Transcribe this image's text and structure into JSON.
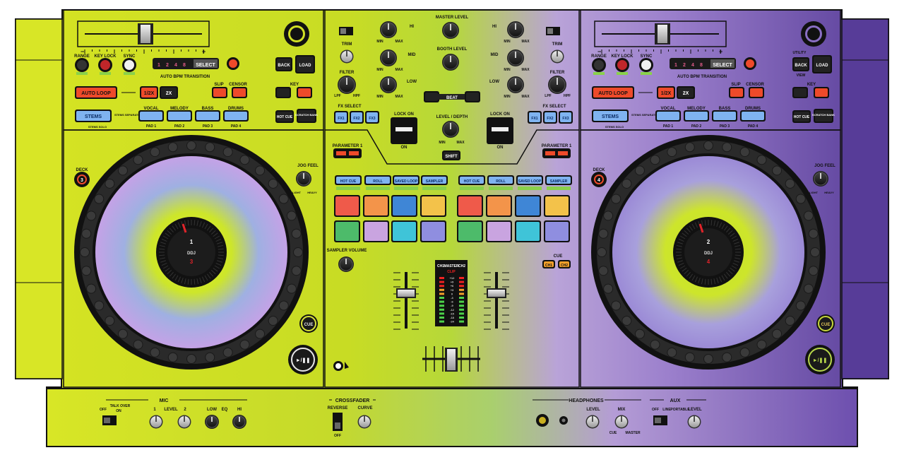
{
  "colors": {
    "lime": "#d8e626",
    "lime_dark": "#c6d81c",
    "purple": "#5a3f9a",
    "lavender": "#b699d8",
    "orange_red": "#ee4a2a",
    "pad_red": "#ef5a4a",
    "pad_orange": "#f3944a",
    "pad_blue": "#3f86d6",
    "pad_yellow": "#f3c24a",
    "pad_green": "#4dbb6a",
    "pad_lilac": "#c9a4e0",
    "pad_cyan": "#3fc4d8",
    "pad_periwinkle": "#8f8ee0",
    "screen_blue": "#7fb3f0"
  },
  "deck_left": {
    "range": "RANGE",
    "key_lock": "KEY LOCK",
    "sync": "SYNC",
    "beats": [
      "1",
      "2",
      "4",
      "8"
    ],
    "select": "SELECT",
    "auto_bpm": "AUTO BPM TRANSITION",
    "back": "BACK",
    "load": "LOAD",
    "auto_loop": "AUTO LOOP",
    "half": "1/2X",
    "double": "2X",
    "slip": "SLIP",
    "censor": "CENSOR",
    "key": "KEY",
    "stems": "STEMS",
    "stems_separate": "STEMS SEPARATE",
    "stems_solo": "STEMS SOLO",
    "vocal": "VOCAL",
    "melody": "MELODY",
    "bass": "BASS",
    "drums": "DRUMS",
    "pads": [
      "PAD 1",
      "PAD 2",
      "PAD 3",
      "PAD 4"
    ],
    "hot_cue": "HOT CUE",
    "scratch_bank": "SCRATCH BANK",
    "deck": "DECK",
    "deck_num": "3",
    "jog_feel": "JOG FEEL",
    "light": "LIGHT",
    "heavy": "HEAVY",
    "platter_top": "1",
    "platter_mid": "DDJ",
    "platter_bottom": "3",
    "cue": "CUE",
    "play": "►/❚❚"
  },
  "deck_right": {
    "range": "RANGE",
    "key_lock": "KEY LOCK",
    "sync": "SYNC",
    "beats": [
      "1",
      "2",
      "4",
      "8"
    ],
    "select": "SELECT",
    "auto_bpm": "AUTO BPM TRANSITION",
    "utility": "UTILITY",
    "back": "BACK",
    "load": "LOAD",
    "view": "VIEW",
    "auto_loop": "AUTO LOOP",
    "half": "1/2X",
    "double": "2X",
    "slip": "SLIP",
    "censor": "CENSOR",
    "key": "KEY",
    "stems": "STEMS",
    "stems_separate": "STEMS SEPARATE",
    "stems_solo": "STEMS SOLO",
    "vocal": "VOCAL",
    "melody": "MELODY",
    "bass": "BASS",
    "drums": "DRUMS",
    "pads": [
      "PAD 1",
      "PAD 2",
      "PAD 3",
      "PAD 4"
    ],
    "hot_cue": "HOT CUE",
    "scratch_bank": "SCRATCH BANK",
    "deck": "DECK",
    "deck_num": "4",
    "jog_feel": "JOG FEEL",
    "light": "LIGHT",
    "heavy": "HEAVY",
    "platter_top": "2",
    "platter_mid": "DDJ",
    "platter_bottom": "4",
    "cue": "CUE",
    "play": "►/❚❚"
  },
  "mixer": {
    "master_level": "MASTER LEVEL",
    "booth_level": "BOOTH LEVEL",
    "trim": "TRIM",
    "hi": "HI",
    "mid": "MID",
    "low": "LOW",
    "filter": "FILTER",
    "lpf": "LPF",
    "hpf": "HPF",
    "min": "MIN",
    "max": "MAX",
    "beat": "BEAT",
    "fx_select": "FX SELECT",
    "fx": [
      "FX1",
      "FX2",
      "FX3"
    ],
    "lock_on": "LOCK ON",
    "on": "ON",
    "level_depth": "LEVEL / DEPTH",
    "shift": "SHIFT",
    "parameter": "PARAMETER 1",
    "modes": [
      "HOT CUE",
      "ROLL",
      "SAVED LOOP",
      "SAMPLER"
    ],
    "sampler_volume": "SAMPLER VOLUME",
    "meter_labels": [
      "CH1",
      "MASTER",
      "CH2"
    ],
    "clip": "CLIP",
    "meter_scale": [
      "+12",
      "+9",
      "+6",
      "+3",
      "0",
      "-3",
      "-6",
      "-9",
      "-12",
      "-15",
      "-18",
      "-24"
    ],
    "cue": "CUE",
    "ch1": "CH1",
    "ch2": "CH2"
  },
  "front": {
    "mic": "MIC",
    "off": "OFF",
    "talk_over": "TALK OVER",
    "on": "ON",
    "level": "LEVEL",
    "ch1": "1",
    "ch2": "2",
    "low": "LOW",
    "eq": "EQ",
    "hi": "HI",
    "crossfader": "CROSSFADER",
    "reverse": "REVERSE",
    "curve": "CURVE",
    "headphones": "HEADPHONES",
    "mix": "MIX",
    "cue": "CUE",
    "master": "MASTER",
    "aux": "AUX",
    "line": "LINE",
    "portable": "PORTABLE",
    "aux_level": "LEVEL"
  }
}
